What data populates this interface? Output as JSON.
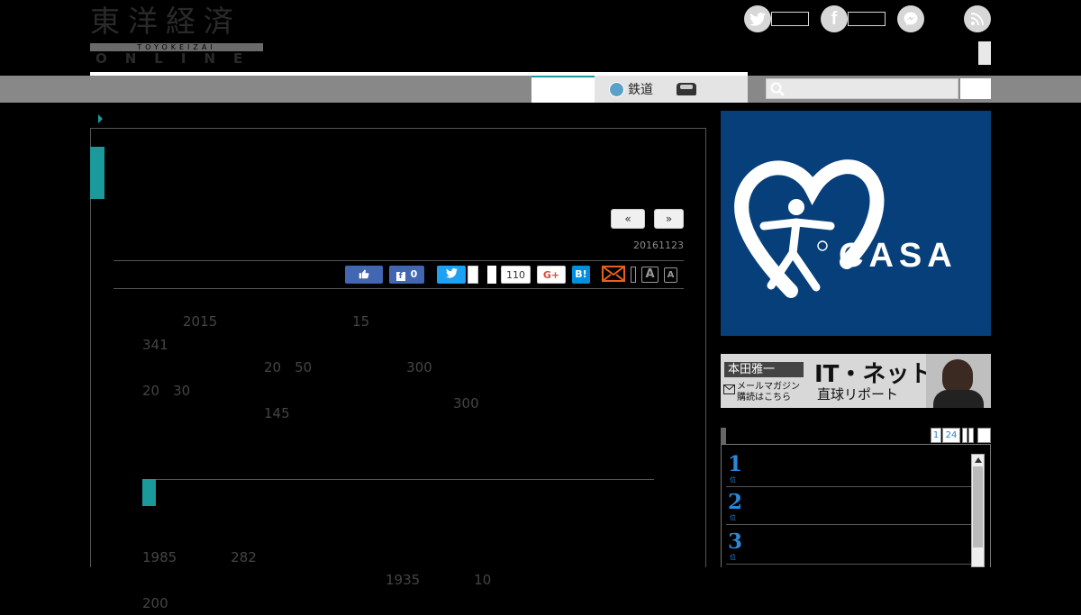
{
  "header": {
    "logo_kanji": "東洋経済",
    "logo_sub": "TOYOKEIZAI",
    "logo_online": "ONLINE"
  },
  "nav": {
    "rail_label": "鉄道"
  },
  "article": {
    "prev_label": "«",
    "next_label": "»",
    "date": "20161123",
    "share": {
      "like_count": "0",
      "tweet_count": "110",
      "gplus_label": "G+",
      "hatena_label": "B!",
      "font_large": "A",
      "font_small": "A"
    },
    "paragraphs": [
      "2015年15341。20年50年300年20年30年145年",
      "300年",
      "1985年282年1935年10年200年"
    ],
    "paragraph_lines": [
      [
        "　　　2015　　　　　　　　　　15　　　　　　　　　　　　　　　　　　　　　　　　　　341　　　　　　　　",
        "　　　　　　　　　20　50　　　　　　　300　　　　　　　　　　　　　　　　　　　　　　　　　20　30",
        "　　　　　　　　　145　　　　　　　　　"
      ],
      [
        "　　　　　　　　　　　　　　　　　　　　　　　300　　　　　　　　　　　　　　　　　　　　　　　　　　　　　",
        "　　　　　　　　　　　　　　　　　　　　　　　　　　　　　　　　　　　　　　　　　　　　　　　　　　　　　　　",
        "　　　　　　　　　　　　　　　　　　　　　　　　　　　　　　　　　　　　　　　　　　　"
      ],
      [
        "　　　　　　　　　　　　　　　　　　　　　　　　　　　　　　　　　　　　　　　　　　　1985　　　　282　　　",
        "　　　　　　　　　　　　　　　　　　1935　　　　10　　　　　　　　　　　　　　　　　　　200　　　　　　　　"
      ]
    ],
    "subheading": "　　　　　　　　　　　　　　　　　　　　　　　　"
  },
  "sidebar": {
    "ad_brand": "CASA",
    "banner_name": "本田雅一",
    "banner_title": "IT・ネット",
    "banner_sub": "直球リポート",
    "banner_line1": "メールマガジン",
    "banner_line2": "購読はこちら",
    "rank_tab_1": "1",
    "rank_tab_2": "24",
    "ranks": [
      {
        "num": "1",
        "sub": "位"
      },
      {
        "num": "2",
        "sub": "位"
      },
      {
        "num": "3",
        "sub": "位"
      }
    ]
  },
  "colors": {
    "accent": "#1a9a9a",
    "navbar": "#888888",
    "ad_bg": "#073f7a",
    "rank_blue": "#2a88d8"
  }
}
